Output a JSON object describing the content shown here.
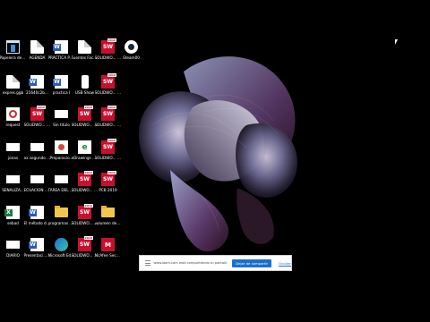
{
  "desktop": {
    "icons": [
      {
        "label": "Papelera de reciclaje",
        "icon": "recycle-bin-icon"
      },
      {
        "label": "AGENDA",
        "icon": "document-icon"
      },
      {
        "label": "PRÁCTICA PROB Y EST",
        "icon": "word-icon"
      },
      {
        "label": "Fuentes Factory",
        "icon": "document-icon"
      },
      {
        "label": "SOLIDWO... Compose...",
        "icon": "solidworks-icon"
      },
      {
        "label": "Steam00",
        "icon": "steam-icon"
      },
      {
        "label": "expres.ggb",
        "icon": "document-icon"
      },
      {
        "label": "21640c2b...",
        "icon": "word-icon"
      },
      {
        "label": "practica l",
        "icon": "word-icon"
      },
      {
        "label": "USB Show",
        "icon": "usb-icon"
      },
      {
        "label": "SOLIDWO... Inspection...",
        "icon": "solidworks-icon"
      },
      {
        "label": "request",
        "icon": "pdf-icon"
      },
      {
        "label": "SOLIDWO... Explorer 2...",
        "icon": "solidworks-icon"
      },
      {
        "label": "Sin titulo",
        "icon": "blank-file-icon"
      },
      {
        "label": "SOLIDWO... 2019",
        "icon": "solidworks-icon"
      },
      {
        "label": "SOLIDWO... Visualize 2...",
        "icon": "solidworks-icon"
      },
      {
        "label": "jonas",
        "icon": "blank-file-icon"
      },
      {
        "label": "ax segundo grado",
        "icon": "blank-file-icon"
      },
      {
        "label": "Preparacio...",
        "icon": "jar-icon"
      },
      {
        "label": "eDrawings 2019 x64...",
        "icon": "edrawings-icon"
      },
      {
        "label": "SOLIDWO... Visualize B...",
        "icon": "solidworks-icon"
      },
      {
        "label": "SENALIZA...",
        "icon": "blank-file-icon"
      },
      {
        "label": "ECUACION DE SEGUND...",
        "icon": "blank-file-icon"
      },
      {
        "label": "TAREA DEL GRUPO A.J.",
        "icon": "blank-file-icon"
      },
      {
        "label": "SOLIDWO... Electrical",
        "icon": "solidworks-icon"
      },
      {
        "label": "PCB 2019",
        "icon": "solidworks-icon"
      },
      {
        "label": "sebad",
        "icon": "excel-icon"
      },
      {
        "label": "El método de Jacobi a...",
        "icon": "word-icon"
      },
      {
        "label": "programas ple",
        "icon": "folder-icon"
      },
      {
        "label": "SOLIDWO... Compose...",
        "icon": "solidworks-icon"
      },
      {
        "label": "volumen de sólido",
        "icon": "folder-icon"
      },
      {
        "label": "DIARIO",
        "icon": "blank-file-icon"
      },
      {
        "label": "Presentaci... - copia",
        "icon": "word-icon"
      },
      {
        "label": "Microsoft Edge",
        "icon": "edge-icon"
      },
      {
        "label": "SOLIDWO... Compose...",
        "icon": "solidworks-icon"
      },
      {
        "label": "McAfee Security Sc...",
        "icon": "mcafee-icon"
      }
    ]
  },
  "share_bar": {
    "message": "www.loom.com está compartiendo tu pantalla.",
    "stop_label": "Dejar de compartir",
    "hide_label": "Ocultar"
  },
  "colors": {
    "background": "#000000",
    "solidworks_red": "#c8102e",
    "share_button": "#1a6fd0"
  }
}
